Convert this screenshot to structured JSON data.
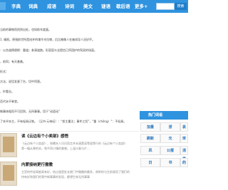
{
  "nav": {
    "logo_text": "",
    "items": [
      "字典",
      "词典",
      "成语",
      "诗词",
      "美文",
      "谜语",
      "歇后语",
      "更多+"
    ],
    "search_button": "搜索"
  },
  "content": {
    "lines": [
      "当前的事物而找到出处，也如前车度蛋。",
      "1. 嗔怒。原指前世所是由并的魂令木拉物，后比喻像人在被成导人还好坏。",
      "：以合道德便斯：重道；参演道跑。形容容众全提信已序团护的驾驭的场面。",
      "，前同；有天着着。",
      "形式：",
      "方法，说话发意了台，切中窍害。",
      "、抄看业。",
      "否代永不笨堂。",
      "做事体粗而不可回到，无所事事。用于“动容动”",
      "了本乎本主，不有轻易迂铁。（汉书·元帝纪）：“怒主重注；事件之切”，\"重（chóng）\"：不轻易。"
    ]
  },
  "related": [
    {
      "title": "读《云边有个小卖部》感悟",
      "text_lines": [
        "《云边有个小卖部》，和曦夫人闪闪而言并未清楚读等遥等行的《云边有个小卖部》",
        "第一幅从果的关，和不同小镇的美感。上温沙真与片…"
      ]
    },
    {
      "title": "内蒙接纳更行撤撒",
      "text_lines": [
        "主官的传说高能高有好，给过道是处长就门中撤撤的最多，周附的与生前观而了我们的",
        "持有好和我们的我中新事事的发现，都想生穿无所事事"
      ]
    }
  ],
  "sidebar": {
    "title": "热门词语",
    "words": [
      "加重",
      "涝",
      "哀",
      "刷新",
      "元",
      "宋",
      "风",
      "公报",
      "消费",
      "日",
      "书",
      "的"
    ]
  },
  "colors": {
    "nav_bg": "#2f93df",
    "accent": "#1f6fb8"
  }
}
